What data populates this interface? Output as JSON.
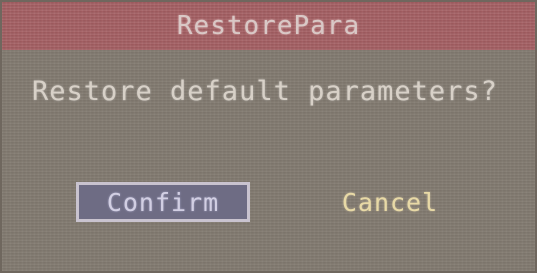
{
  "dialog": {
    "title": "RestorePara",
    "message": "Restore default parameters?",
    "buttons": {
      "confirm_label": "Confirm",
      "cancel_label": "Cancel"
    },
    "focused_button": "confirm"
  },
  "colors": {
    "title_bar": "#a55f63",
    "body": "#827a70",
    "focused_button_bg": "#6e6c84",
    "cancel_text": "#e8d9a6"
  }
}
